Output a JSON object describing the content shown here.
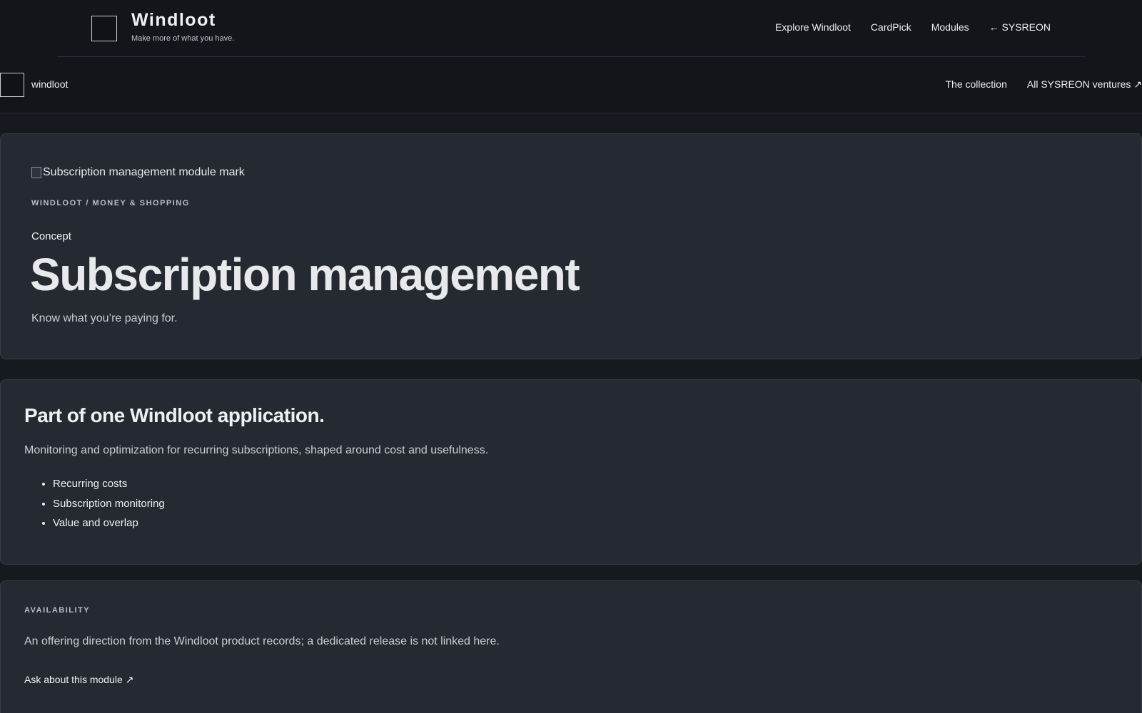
{
  "header": {
    "brand_name": "Windloot",
    "brand_tagline": "Make more of what you have.",
    "nav": [
      "Explore Windloot",
      "CardPick",
      "Modules",
      "← SYSREON"
    ]
  },
  "subheader": {
    "name": "windloot",
    "nav": [
      "The collection",
      "All SYSREON ventures ↗"
    ]
  },
  "hero": {
    "module_mark_alt": "Subscription management module mark",
    "eyebrow": "WINDLOOT / MONEY & SHOPPING",
    "status": "Concept",
    "title": "Subscription management",
    "subtitle": "Know what you’re paying for."
  },
  "about": {
    "title": "Part of one Windloot application.",
    "description": "Monitoring and optimization for recurring subscriptions, shaped around cost and usefulness.",
    "features": [
      "Recurring costs",
      "Subscription monitoring",
      "Value and overlap"
    ]
  },
  "availability": {
    "label": "AVAILABILITY",
    "description": "An offering direction from the Windloot product records; a dedicated release is not linked here.",
    "link": "Ask about this module ↗"
  }
}
